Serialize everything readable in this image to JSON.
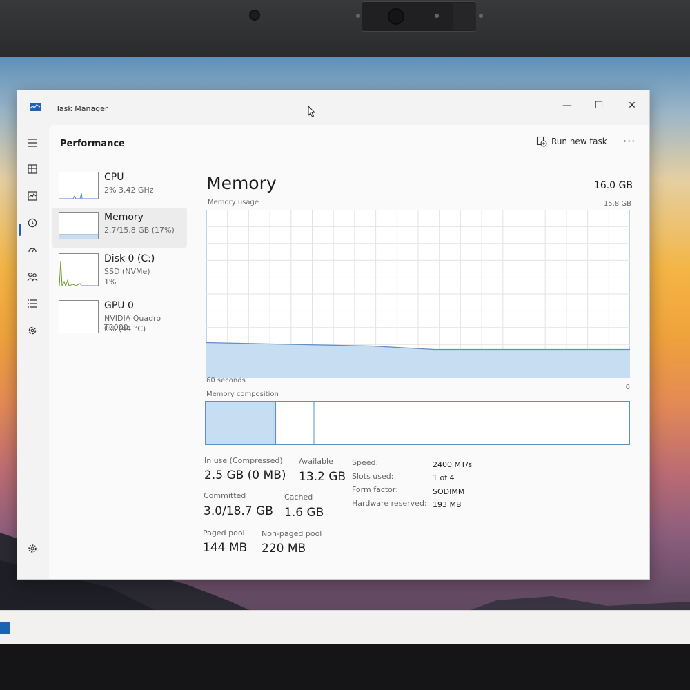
{
  "window": {
    "title": "Task Manager",
    "minimize_glyph": "—",
    "maximize_glyph": "☐",
    "close_glyph": "✕"
  },
  "header": {
    "section": "Performance",
    "run_new_task": "Run new task",
    "more": "···"
  },
  "nav": {
    "items": [
      {
        "icon": "hamburger-menu-icon"
      },
      {
        "icon": "processes-icon"
      },
      {
        "icon": "performance-icon",
        "active": true
      },
      {
        "icon": "app-history-icon"
      },
      {
        "icon": "startup-apps-icon"
      },
      {
        "icon": "users-icon"
      },
      {
        "icon": "details-icon"
      },
      {
        "icon": "services-icon"
      },
      {
        "icon": "settings-icon"
      }
    ]
  },
  "resources": [
    {
      "name": "CPU",
      "line1": "2% 3.42 GHz",
      "line2": ""
    },
    {
      "name": "Memory",
      "line1": "2.7/15.8 GB (17%)",
      "line2": "",
      "active": true
    },
    {
      "name": "Disk 0 (C:)",
      "line1": "SSD (NVMe)",
      "line2": "1%"
    },
    {
      "name": "GPU 0",
      "line1": "NVIDIA Quadro T2000",
      "line2": "0% (44 °C)"
    }
  ],
  "memory": {
    "title": "Memory",
    "total": "16.0 GB",
    "usage_label": "Memory usage",
    "usage_max": "15.8 GB",
    "time_label": "60 seconds",
    "zero_label": "0",
    "composition_label": "Memory composition",
    "usage_fraction": 0.17,
    "composition": {
      "in_use_fraction": 0.16,
      "modified_fraction": 0.002,
      "standby_fraction": 0.09
    }
  },
  "stats": {
    "in_use_label": "In use (Compressed)",
    "in_use_value": "2.5 GB (0 MB)",
    "available_label": "Available",
    "available_value": "13.2 GB",
    "committed_label": "Committed",
    "committed_value": "3.0/18.7 GB",
    "cached_label": "Cached",
    "cached_value": "1.6 GB",
    "paged_label": "Paged pool",
    "paged_value": "144 MB",
    "nonpaged_label": "Non-paged pool",
    "nonpaged_value": "220 MB"
  },
  "hardware": [
    {
      "label": "Speed:",
      "value": "2400 MT/s"
    },
    {
      "label": "Slots used:",
      "value": "1 of 4"
    },
    {
      "label": "Form factor:",
      "value": "SODIMM"
    },
    {
      "label": "Hardware reserved:",
      "value": "193 MB"
    }
  ],
  "colors": {
    "memory_fill": "#c7ddf1",
    "memory_line": "#5f8fc6",
    "accent": "#1c62b9",
    "disk_graph": "#6c9a2b"
  }
}
